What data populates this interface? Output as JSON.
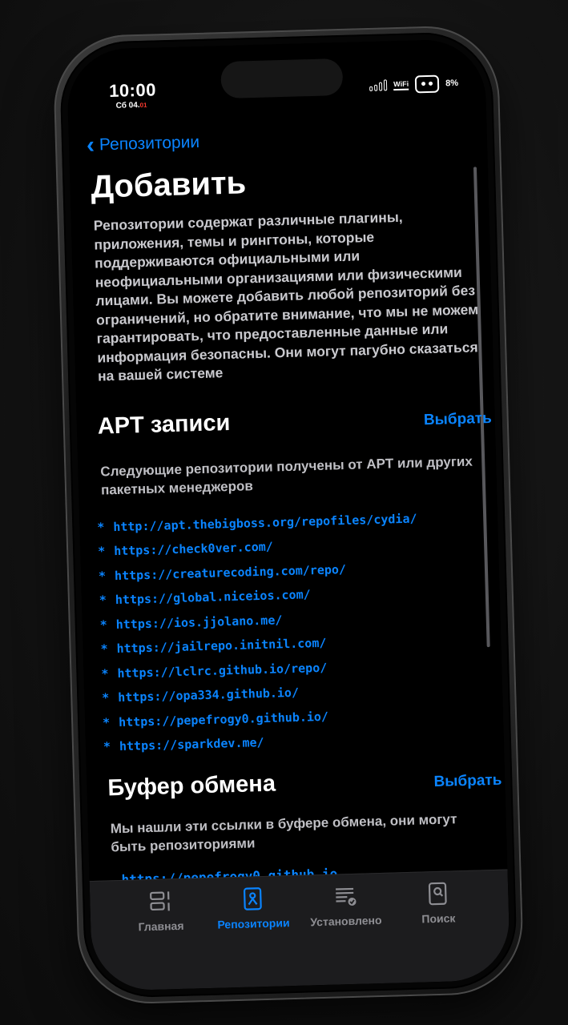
{
  "status": {
    "time": "10:00",
    "date": "Сб 04.",
    "date_red": "01",
    "wifi": "WiFi",
    "battery": "8%"
  },
  "nav": {
    "back_label": "Репозитории"
  },
  "page": {
    "title": "Добавить",
    "description": "Репозитории содержат различные плагины, приложения, темы и рингтоны, которые поддерживаются официальными или неофициальными организациями или физическими лицами. Вы можете добавить любой репозиторий без ограничений, но обратите внимание, что мы не можем гарантировать, что предоставленные данные или информация безопасны. Они могут пагубно сказаться на вашей системе"
  },
  "apt": {
    "title": "APT записи",
    "select": "Выбрать",
    "description": "Следующие репозитории получены от APT или других пакетных менеджеров",
    "bullet": "*",
    "repos": [
      "http://apt.thebigboss.org/repofiles/cydia/",
      "https://check0ver.com/",
      "https://creaturecoding.com/repo/",
      "https://global.niceios.com/",
      "https://ios.jjolano.me/",
      "https://jailrepo.initnil.com/",
      "https://lclrc.github.io/repo/",
      "https://opa334.github.io/",
      "https://pepefrogy0.github.io/",
      "https://sparkdev.me/"
    ]
  },
  "clipboard": {
    "title": "Буфер обмена",
    "select": "Выбрать",
    "description": "Мы нашли эти ссылки в буфере обмена, они могут быть репозиториями",
    "url": "https://pepefrogy0.github.io"
  },
  "tabs": [
    {
      "label": "Главная",
      "icon": "home-icon"
    },
    {
      "label": "Репозитории",
      "icon": "repositories-icon",
      "active": true
    },
    {
      "label": "Установлено",
      "icon": "installed-icon"
    },
    {
      "label": "Поиск",
      "icon": "search-icon"
    }
  ],
  "colors": {
    "accent": "#0a84ff",
    "background": "#000000",
    "tabbar": "#1c1c1e"
  }
}
